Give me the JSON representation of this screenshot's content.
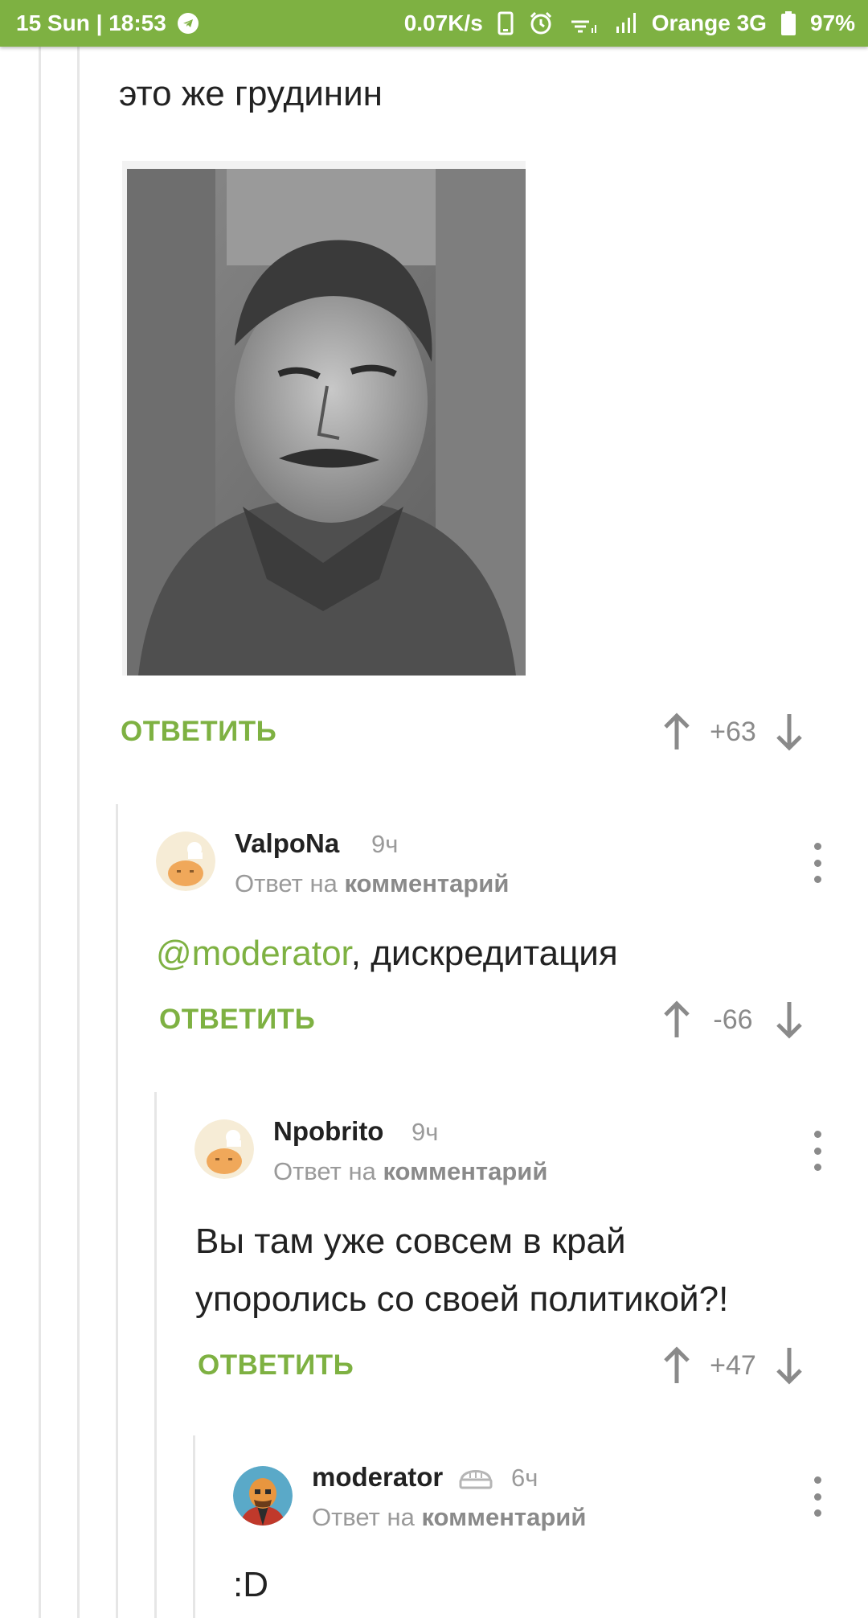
{
  "status_bar": {
    "date_time": "15 Sun | 18:53",
    "speed": "0.07K/s",
    "carrier": "Orange 3G",
    "battery": "97%"
  },
  "comment_top": {
    "text": "это же грудинин",
    "reply_label": "ОТВЕТИТЬ",
    "score": "+63"
  },
  "comment_2": {
    "username": "ValpoNa",
    "time": "9ч",
    "answer_prefix": "Ответ на",
    "answer_target": "комментарий",
    "mention": "@moderator",
    "text": ",  дискредитация",
    "reply_label": "ОТВЕТИТЬ",
    "score": "-66"
  },
  "comment_3": {
    "username": "Npobrito",
    "time": "9ч",
    "answer_prefix": "Ответ на",
    "answer_target": "комментарий",
    "text_line1": "Вы там уже совсем в край",
    "text_line2": "упоролись со своей политикой?!",
    "reply_label": "ОТВЕТИТЬ",
    "score": "+47"
  },
  "comment_4": {
    "username": "moderator",
    "time": "6ч",
    "answer_prefix": "Ответ на",
    "answer_target": "комментарий",
    "text": ":D"
  },
  "colors": {
    "accent": "#7eb142",
    "muted": "#9a9a9a",
    "text": "#222222"
  },
  "icons": {
    "upvote": "arrow-up-icon",
    "downvote": "arrow-down-icon",
    "menu": "more-vertical-icon",
    "telegram": "telegram-icon",
    "badge": "pie-badge-icon"
  }
}
